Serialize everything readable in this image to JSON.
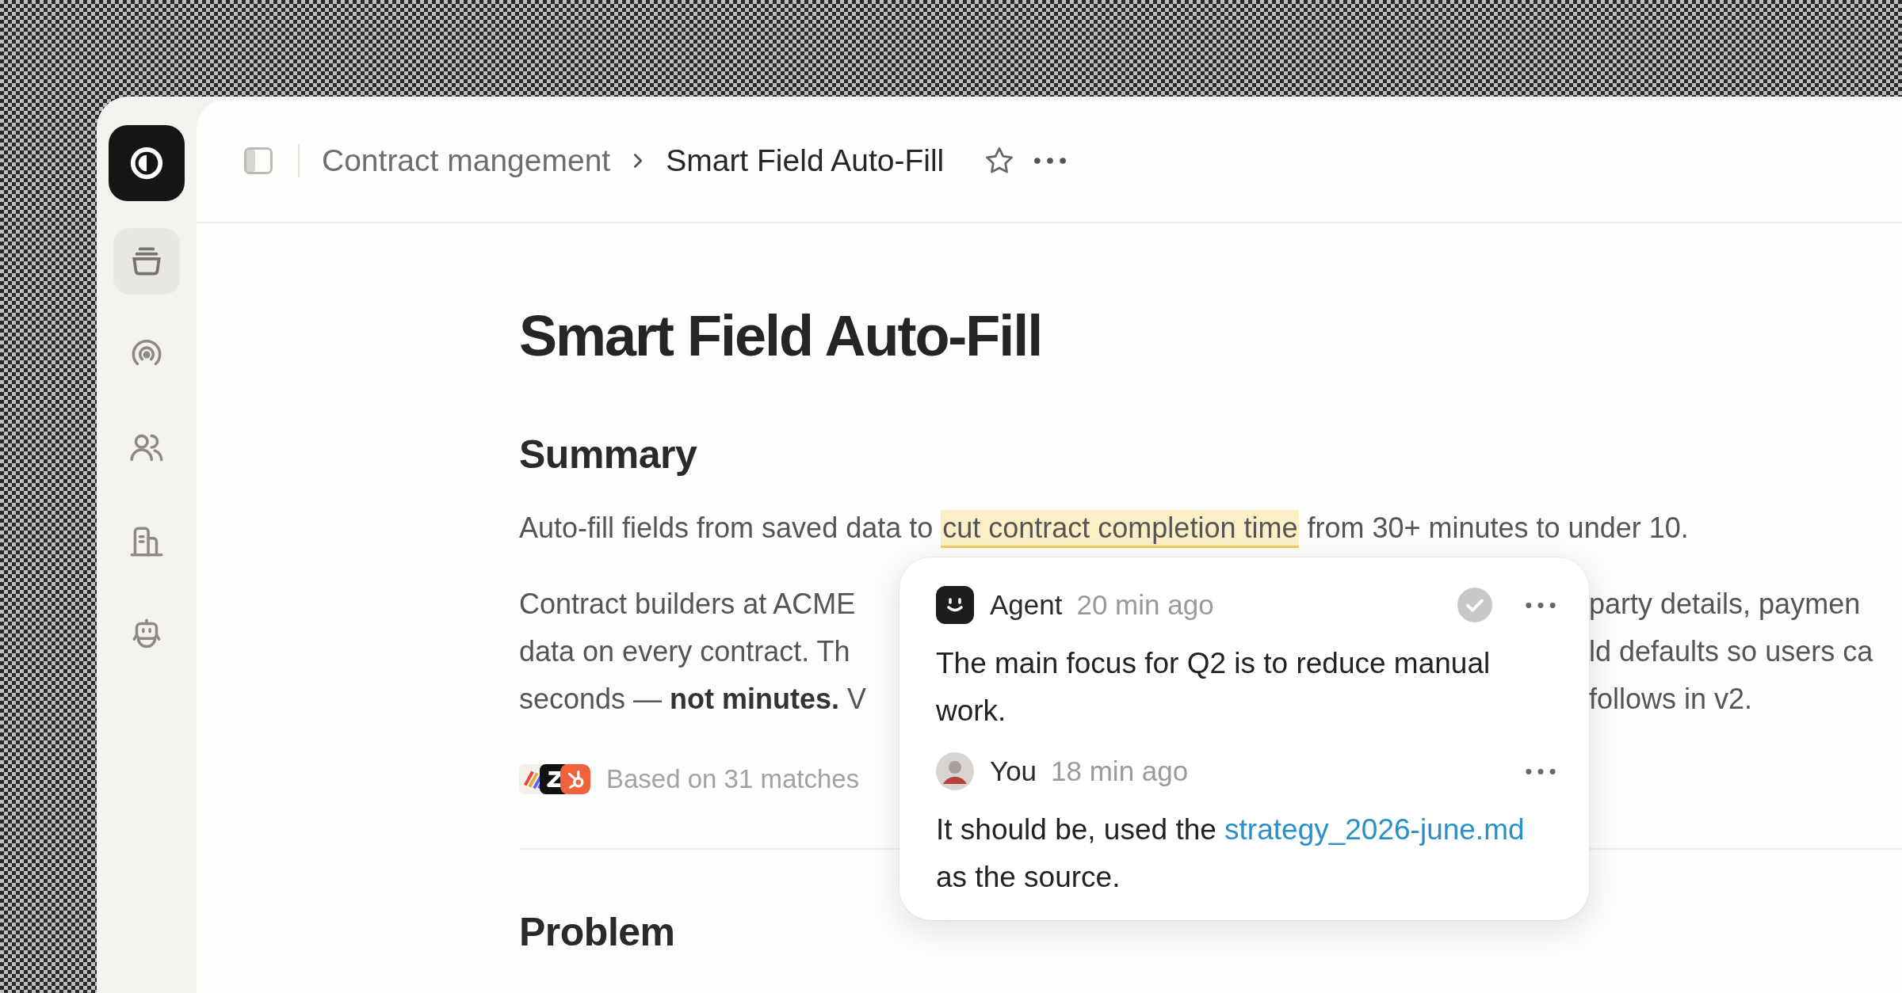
{
  "sidebar": {
    "items": [
      {
        "selected": true
      },
      {
        "selected": false
      },
      {
        "selected": false
      },
      {
        "selected": false
      },
      {
        "selected": false
      }
    ]
  },
  "header": {
    "breadcrumb": [
      {
        "label": "Contract mangement",
        "selected": false
      },
      {
        "label": "Smart Field Auto-Fill",
        "selected": true
      }
    ]
  },
  "document": {
    "title": "Smart Field Auto-Fill",
    "summary": {
      "heading": "Summary",
      "lead_before": "Auto-fill fields from saved data to",
      "highlight": "cut contract completion time",
      "lead_after": "from 30+ minutes to under 10.",
      "paragraph_lines": [
        {
          "left": "Contract builders at ACME",
          "right": "party details, paymen"
        },
        {
          "left": "data on every contract. Th",
          "right": "ld defaults so users ca"
        },
        {
          "left": "seconds — **not minutes.** V",
          "right": "follows in v2."
        }
      ],
      "sources": {
        "text": "Based on 31 matches"
      }
    },
    "problem": {
      "heading": "Problem"
    }
  },
  "comment_popup": {
    "comments": [
      {
        "kind": "agent",
        "author": "Agent",
        "time": "20 min ago",
        "text": "The main focus for Q2 is to reduce manual work."
      },
      {
        "kind": "user",
        "author": "You",
        "time": "18 min ago",
        "text": "It should be, used the",
        "link": "strategy_2026-june.md",
        "text_after": "as the source."
      }
    ]
  }
}
